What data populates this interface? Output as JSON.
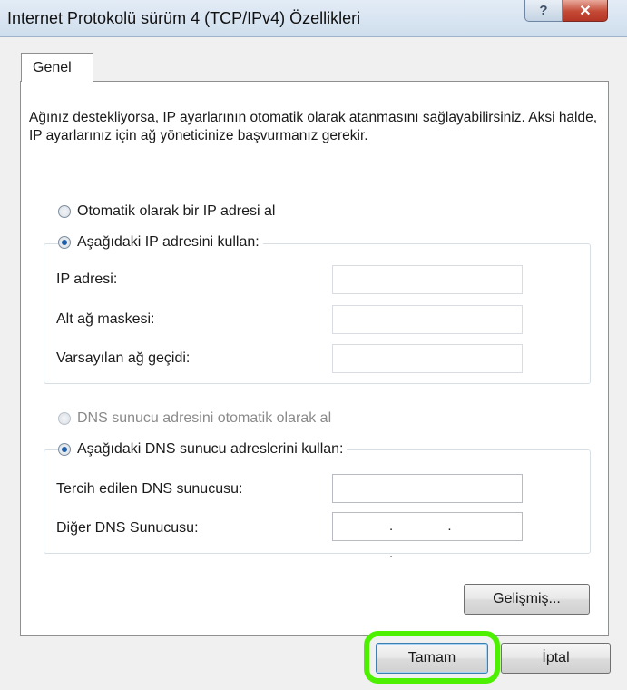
{
  "window": {
    "title": "Internet Protokolü sürüm 4 (TCP/IPv4) Özellikleri",
    "help_icon": "question-icon",
    "close_icon": "close-icon"
  },
  "tabs": [
    {
      "label": "Genel"
    }
  ],
  "description": "Ağınız destekliyorsa, IP ayarlarının otomatik olarak atanmasını sağlayabilirsiniz. Aksi halde, IP ayarlarınız için ağ yöneticinize başvurmanız gerekir.",
  "ip_section": {
    "auto_option": "Otomatik olarak bir IP adresi al",
    "manual_option": "Aşağıdaki IP adresini kullan:",
    "selected": "manual",
    "fields": [
      {
        "label": "IP adresi:",
        "value": ""
      },
      {
        "label": "Alt ağ maskesi:",
        "value": ""
      },
      {
        "label": "Varsayılan ağ geçidi:",
        "value": ""
      }
    ]
  },
  "dns_section": {
    "auto_option": "DNS sunucu adresini otomatik olarak al",
    "manual_option": "Aşağıdaki DNS sunucu adreslerini kullan:",
    "selected": "manual",
    "fields": [
      {
        "label": "Tercih edilen DNS sunucusu:",
        "value": ""
      },
      {
        "label": "Diğer DNS Sunucusu:",
        "value": ". . ."
      }
    ]
  },
  "buttons": {
    "advanced": "Gelişmiş...",
    "ok": "Tamam",
    "cancel": "İptal"
  },
  "colors": {
    "highlight": "#4cf000",
    "radio_selected": "#1e5fa8",
    "close_button": "#c44a36"
  }
}
